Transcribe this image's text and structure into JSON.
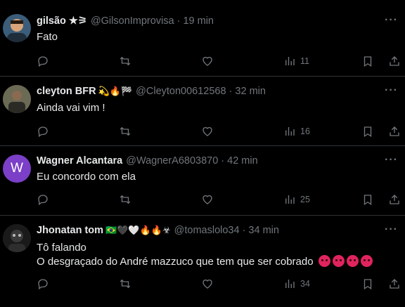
{
  "tweets": [
    {
      "name": "gilsão ★⚞",
      "handle": "@GilsonImprovisa",
      "time": "19 min",
      "lines": [
        "Fato"
      ],
      "views": "11",
      "avatar_color": "#3b5d7a",
      "avatar_icon": "avatar-photo"
    },
    {
      "name": "cleyton BFR",
      "badges": "💫🔥🏁",
      "handle": "@Cleyton00612568",
      "time": "32 min",
      "lines": [
        "Ainda vai vim !"
      ],
      "views": "16",
      "avatar_color": "#5a5448",
      "avatar_icon": "avatar-photo"
    },
    {
      "name": "Wagner Alcantara",
      "handle": "@WagnerA6803870",
      "time": "42 min",
      "lines": [
        "Eu concordo com ela"
      ],
      "views": "25",
      "avatar_color": "#7b3fc8",
      "avatar_letter": "W"
    },
    {
      "name": "Jhonatan tom",
      "badges": "🇧🇷🖤🤍🔥🔥☣",
      "handle": "@tomaslolo34",
      "time": "34 min",
      "lines": [
        "Tô falando",
        "O desgraçado do André mazzuco que tem que ser cobrado"
      ],
      "views": "34",
      "avatar_color": "#2b2b2b",
      "avatar_icon": "avatar-photo"
    }
  ],
  "separator": "·",
  "more_icon": "more-icon",
  "accent": "#71767b"
}
